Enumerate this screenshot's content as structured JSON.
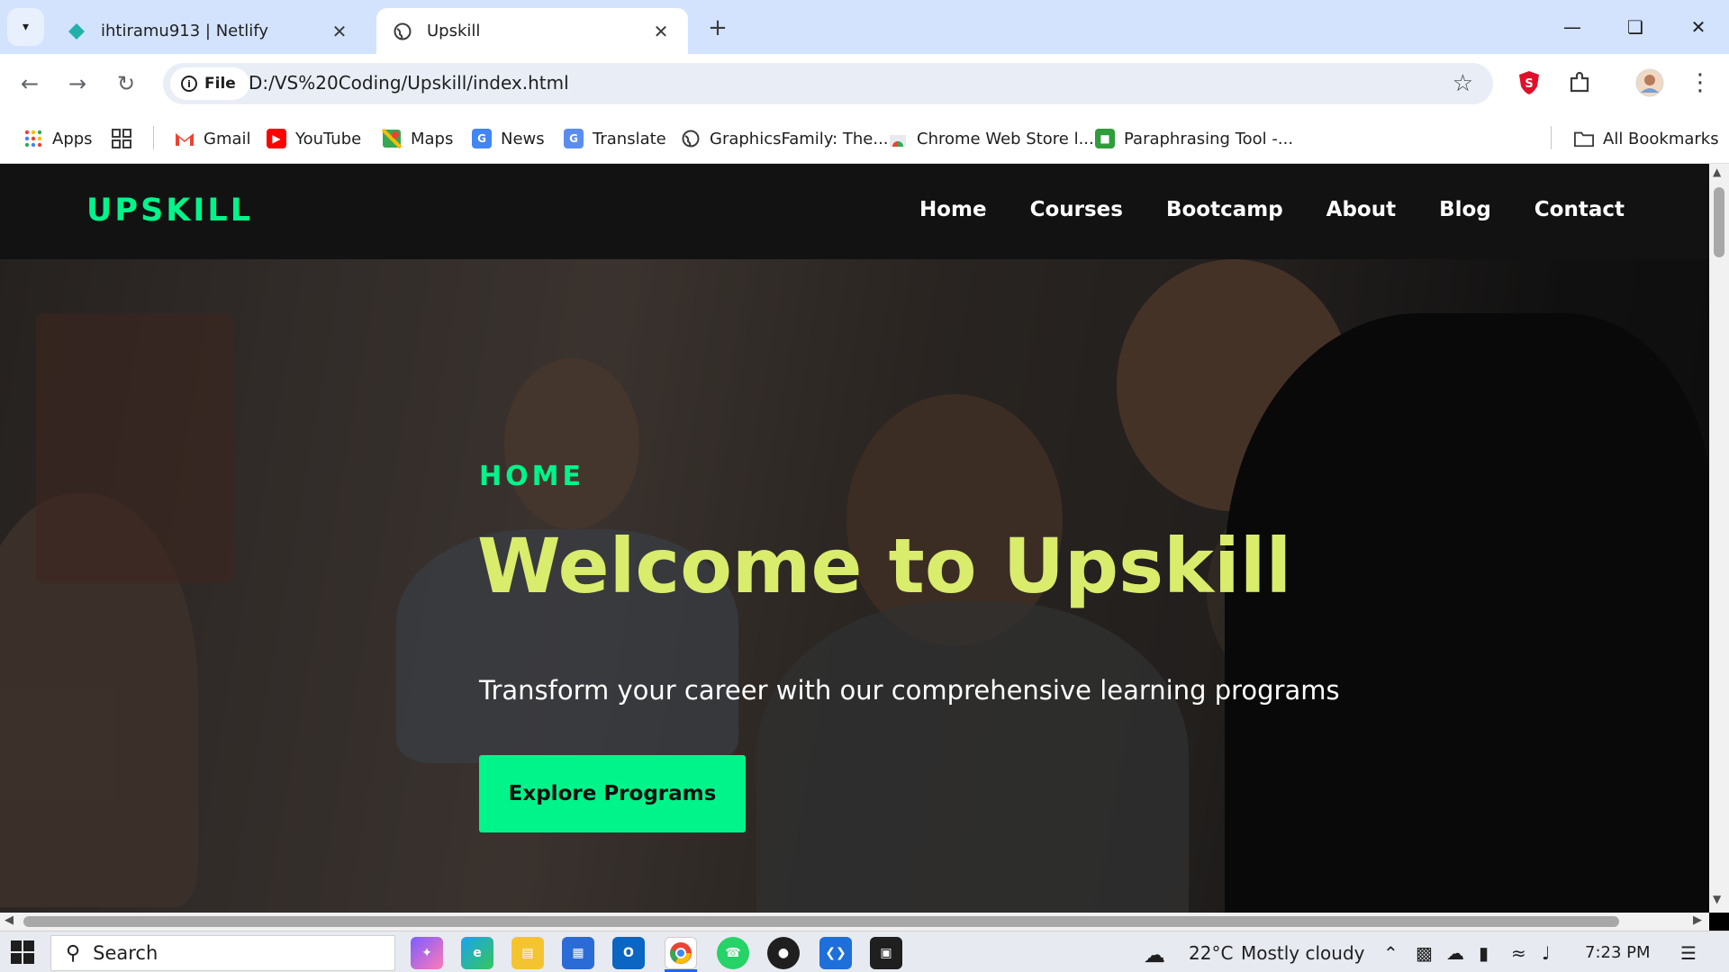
{
  "browser": {
    "tabs": [
      {
        "title": "ihtiramu913 | Netlify",
        "active": false
      },
      {
        "title": "Upskill",
        "active": true
      }
    ],
    "chip_label": "File",
    "url": "D:/VS%20Coding/Upskill/index.html",
    "bookmarks": [
      {
        "label": "Apps"
      },
      {
        "label": "Gmail"
      },
      {
        "label": "YouTube"
      },
      {
        "label": "Maps"
      },
      {
        "label": "News"
      },
      {
        "label": "Translate"
      },
      {
        "label": "GraphicsFamily: The..."
      },
      {
        "label": "Chrome Web Store l..."
      },
      {
        "label": "Paraphrasing Tool -..."
      }
    ],
    "all_bookmarks": "All Bookmarks"
  },
  "site": {
    "logo": "UPSKILL",
    "nav": [
      "Home",
      "Courses",
      "Bootcamp",
      "About",
      "Blog",
      "Contact"
    ],
    "hero": {
      "eyebrow": "HOME",
      "title": "Welcome to Upskill",
      "subtitle": "Transform your career with our comprehensive learning programs",
      "cta": "Explore Programs"
    }
  },
  "taskbar": {
    "search": "Search",
    "weather_temp": "22°C",
    "weather_text": "Mostly cloudy",
    "time": "7:23 PM"
  },
  "colors": {
    "accent_green": "#00f48a",
    "headline_yellow": "#d9ec6c",
    "nav_bg": "#121212",
    "tabstrip_bg": "#d3e3fd"
  }
}
